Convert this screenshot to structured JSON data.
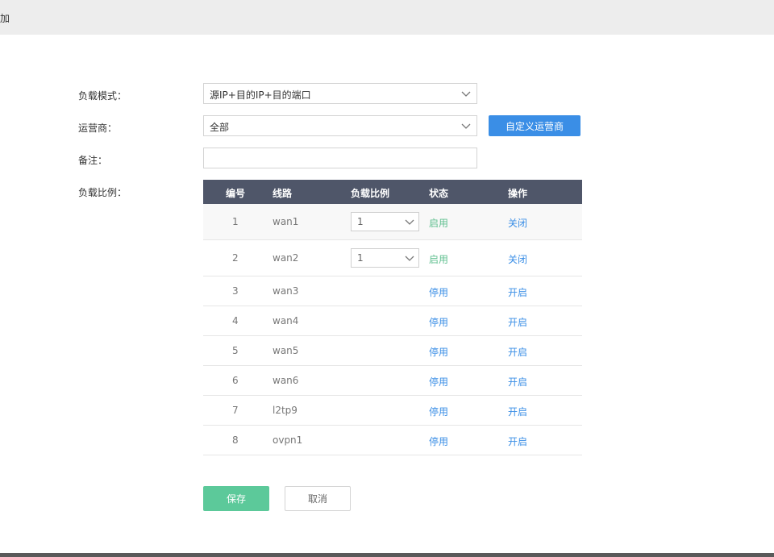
{
  "window": {
    "title": "加"
  },
  "form": {
    "mode_label": "负载模式：",
    "mode_value": "源IP+目的IP+目的端口",
    "carrier_label": "运营商：",
    "carrier_value": "全部",
    "custom_carrier_button": "自定义运营商",
    "remark_label": "备注：",
    "remark_value": "",
    "ratio_label": "负载比例："
  },
  "table": {
    "headers": [
      "编号",
      "线路",
      "负载比例",
      "状态",
      "操作"
    ],
    "rows": [
      {
        "no": "1",
        "line": "wan1",
        "ratio": "1",
        "status": "启用",
        "op": "关闭"
      },
      {
        "no": "2",
        "line": "wan2",
        "ratio": "1",
        "status": "启用",
        "op": "关闭"
      },
      {
        "no": "3",
        "line": "wan3",
        "ratio": "",
        "status": "停用",
        "op": "开启"
      },
      {
        "no": "4",
        "line": "wan4",
        "ratio": "",
        "status": "停用",
        "op": "开启"
      },
      {
        "no": "5",
        "line": "wan5",
        "ratio": "",
        "status": "停用",
        "op": "开启"
      },
      {
        "no": "6",
        "line": "wan6",
        "ratio": "",
        "status": "停用",
        "op": "开启"
      },
      {
        "no": "7",
        "line": "l2tp9",
        "ratio": "",
        "status": "停用",
        "op": "开启"
      },
      {
        "no": "8",
        "line": "ovpn1",
        "ratio": "",
        "status": "停用",
        "op": "开启"
      }
    ]
  },
  "actions": {
    "save": "保存",
    "cancel": "取消"
  },
  "colors": {
    "header_bg": "#4f5669",
    "primary_blue": "#3a8ee6",
    "save_green": "#5cc99a",
    "enabled_green": "#5fbf8f"
  }
}
